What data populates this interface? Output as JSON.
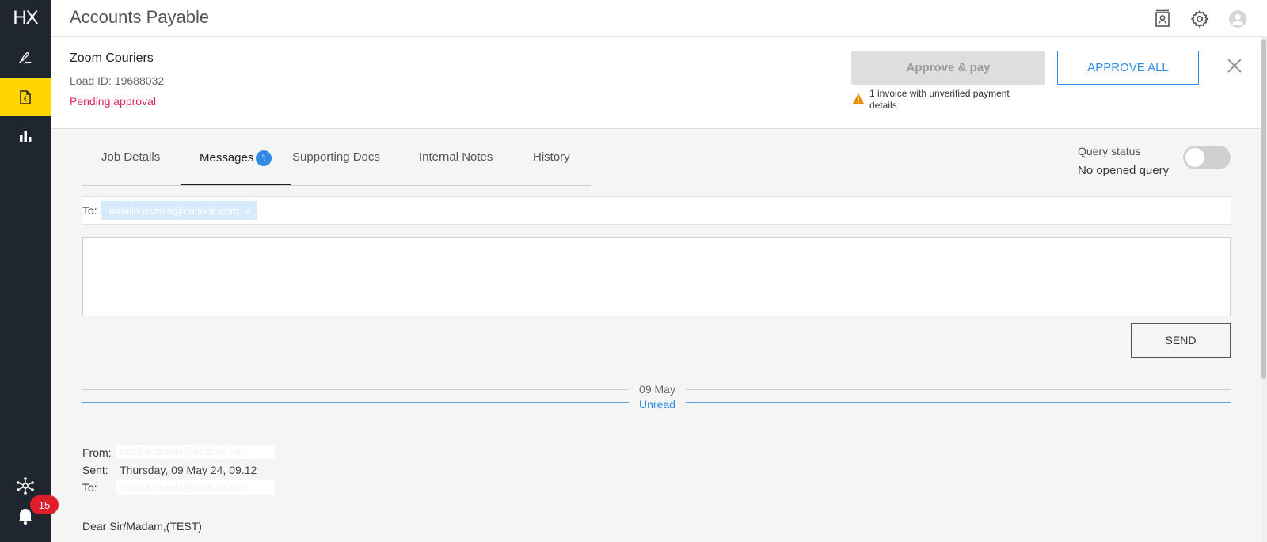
{
  "app": {
    "logo": "HX",
    "title": "Accounts Payable"
  },
  "sidebar": {
    "items": [
      {
        "name": "signature-icon"
      },
      {
        "name": "invoice-icon",
        "active": true
      },
      {
        "name": "bar-chart-icon"
      },
      {
        "name": "network-icon"
      },
      {
        "name": "bell-icon"
      }
    ],
    "notification_count": "15"
  },
  "topbar_icons": [
    "contact-card-icon",
    "gear-icon",
    "user-avatar-icon"
  ],
  "header": {
    "supplier": "Zoom Couriers",
    "load_id": "Load ID: 19688032",
    "status": "Pending approval",
    "approve_pay_label": "Approve & pay",
    "approve_all_label": "APPROVE ALL",
    "warning": "1 invoice with unverified payment details"
  },
  "tabs": [
    {
      "label": "Job Details"
    },
    {
      "label": "Messages",
      "badge": "1",
      "active": true
    },
    {
      "label": "Supporting Docs"
    },
    {
      "label": "Internal Notes"
    },
    {
      "label": "History"
    }
  ],
  "query": {
    "label": "Query status",
    "value": "No opened query",
    "toggle_on": false
  },
  "compose": {
    "to_label": "To:",
    "recipient": "natalia.osaula@outlook.com",
    "message_value": "",
    "send_label": "SEND"
  },
  "thread": {
    "date": "09 May",
    "unread_label": "Unread",
    "from_label": "From:",
    "from_value": "natalia.osaula@outlook.com",
    "sent_label": "Sent:",
    "sent_value": "Thursday, 09 May 24, 09.12",
    "to_label": "To:",
    "to_value": "natalia.osaula@outlook.com",
    "body_first_line": "Dear Sir/Madam,(TEST)"
  },
  "colors": {
    "sidebar_bg": "#1f2630",
    "active_nav": "#ffd400",
    "accent_blue": "#2f8be6",
    "pending_red": "#e0245e",
    "warning_orange": "#f08a00",
    "badge_red": "#e01e2b"
  }
}
